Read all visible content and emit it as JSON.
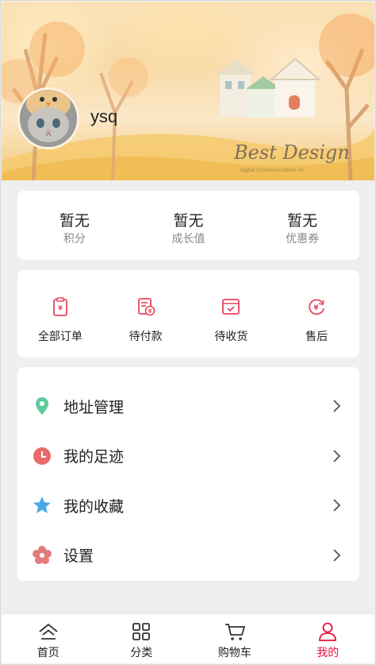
{
  "profile": {
    "username": "ysq"
  },
  "stats": [
    {
      "value": "暂无",
      "label": "积分"
    },
    {
      "value": "暂无",
      "label": "成长值"
    },
    {
      "value": "暂无",
      "label": "优惠券"
    }
  ],
  "orders": [
    {
      "label": "全部订单",
      "icon": "clipboard-yen-icon"
    },
    {
      "label": "待付款",
      "icon": "bill-yen-icon"
    },
    {
      "label": "待收货",
      "icon": "box-check-icon"
    },
    {
      "label": "售后",
      "icon": "yen-refresh-icon"
    }
  ],
  "menu": [
    {
      "label": "地址管理",
      "icon": "location-pin-icon",
      "color": "#5ecb9b"
    },
    {
      "label": "我的足迹",
      "icon": "clock-icon",
      "color": "#e86a6a"
    },
    {
      "label": "我的收藏",
      "icon": "star-icon",
      "color": "#4aa9e8"
    },
    {
      "label": "设置",
      "icon": "flower-settings-icon",
      "color": "#e57a7a"
    }
  ],
  "tabbar": [
    {
      "label": "首页",
      "icon": "home-icon"
    },
    {
      "label": "分类",
      "icon": "grid-icon"
    },
    {
      "label": "购物车",
      "icon": "cart-icon"
    },
    {
      "label": "我的",
      "icon": "user-icon",
      "active": true
    }
  ],
  "colors": {
    "accent": "#e8123b",
    "order_icon": "#e8445c"
  },
  "banner": {
    "brand_text": "Best Design"
  }
}
